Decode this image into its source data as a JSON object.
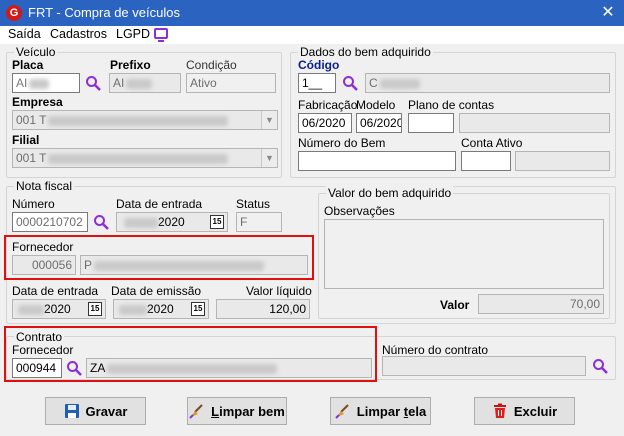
{
  "window": {
    "title": "FRT - Compra de veículos",
    "app_icon_letter": "G",
    "close_glyph": "✕"
  },
  "menu": {
    "items": [
      "Saída",
      "Cadastros",
      "LGPD"
    ]
  },
  "veiculo": {
    "legend": "Veículo",
    "placa_label": "Placa",
    "placa_value": "AI",
    "prefixo_label": "Prefixo",
    "prefixo_value": "AI",
    "condicao_label": "Condição",
    "condicao_value": "Ativo",
    "empresa_label": "Empresa",
    "empresa_value": "001 T",
    "filial_label": "Filial",
    "filial_value": "001 T"
  },
  "bem": {
    "legend": "Dados do bem adquirido",
    "codigo_label": "Código",
    "codigo_value": "1__",
    "codigo_desc": "C",
    "fabricacao_label": "Fabricação",
    "fabricacao_value": "06/2020",
    "modelo_label": "Modelo",
    "modelo_value": "06/2020",
    "plano_label": "Plano de contas",
    "plano_value": "",
    "numero_bem_label": "Número do Bem",
    "numero_bem_value": "",
    "conta_ativo_label": "Conta Ativo",
    "conta_ativo_value": ""
  },
  "nota": {
    "legend": "Nota fiscal",
    "numero_label": "Número",
    "numero_value": "0000210702",
    "data_entrada_label": "Data de entrada",
    "data_entrada_value": "2020",
    "status_label": "Status",
    "status_value": "F",
    "fornecedor_label": "Fornecedor",
    "fornecedor_code": "000056",
    "fornecedor_name": "P",
    "data_entrada2_label": "Data de entrada",
    "data_entrada2_value": "2020",
    "data_emissao_label": "Data de emissão",
    "data_emissao_value": "2020",
    "valor_liquido_label": "Valor líquido",
    "valor_liquido_value": "120,00",
    "cal_glyph": "15"
  },
  "valor_bem": {
    "legend": "Valor do bem adquirido",
    "obs_label": "Observações",
    "valor_label": "Valor",
    "valor_value": "70,00"
  },
  "contrato": {
    "legend": "Contrato",
    "fornecedor_label": "Fornecedor",
    "fornecedor_code": "000944",
    "fornecedor_name": "ZA",
    "numero_label": "Número do contrato",
    "numero_value": ""
  },
  "buttons": {
    "gravar": "Gravar",
    "limpar_bem_pre": "L",
    "limpar_bem_rest": "impar bem",
    "limpar_tela_pre": "Limpar ",
    "limpar_tela_key": "t",
    "limpar_tela_rest": "ela",
    "excluir": "Excluir"
  },
  "colors": {
    "accent": "#8c2fd6",
    "title_bar": "#2b63c1",
    "highlight": "#e01010"
  }
}
